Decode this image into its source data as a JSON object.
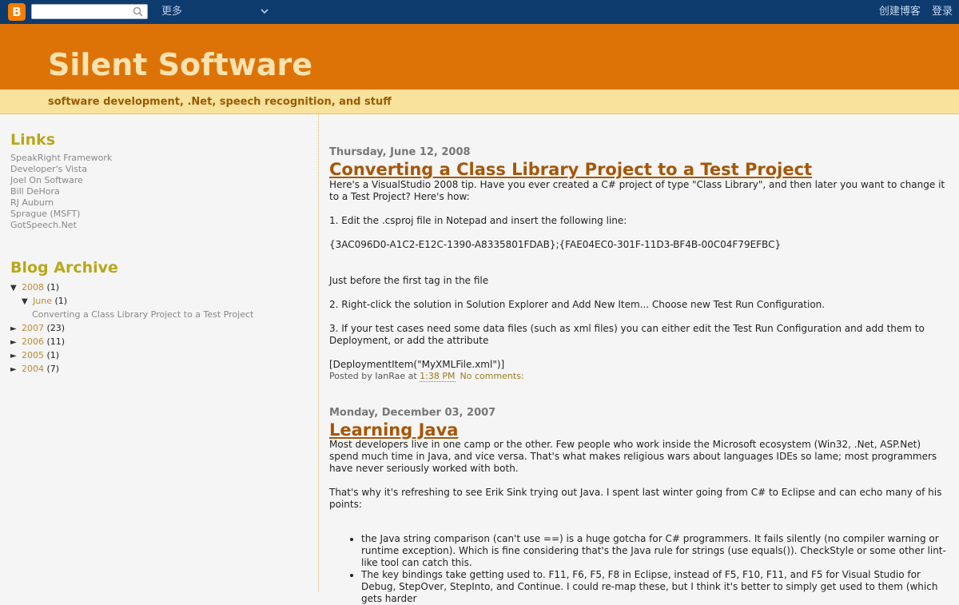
{
  "navbar": {
    "logo": "B",
    "search_placeholder": "",
    "more_label": "更多",
    "create_blog": "创建博客",
    "login": "登录"
  },
  "header": {
    "title": "Silent Software",
    "description": "software development, .Net, speech recognition, and stuff"
  },
  "sidebar": {
    "links_heading": "Links",
    "links": [
      "SpeakRight Framework",
      "Developer's Vista",
      "Joel On Software",
      "Bill DeHora",
      "RJ Auburn",
      "Sprague (MSFT)",
      "GotSpeech.Net"
    ],
    "archive_heading": "Blog Archive",
    "archive": {
      "y2008": {
        "label": "2008",
        "count": "(1)",
        "toggle": "▼"
      },
      "june": {
        "label": "June",
        "count": "(1)",
        "toggle": "▼"
      },
      "june_post": "Converting a Class Library Project to a Test Project",
      "y2007": {
        "label": "2007",
        "count": "(23)",
        "toggle": "►"
      },
      "y2006": {
        "label": "2006",
        "count": "(11)",
        "toggle": "►"
      },
      "y2005": {
        "label": "2005",
        "count": "(1)",
        "toggle": "►"
      },
      "y2004": {
        "label": "2004",
        "count": "(7)",
        "toggle": "►"
      }
    }
  },
  "posts": [
    {
      "date": "Thursday, June 12, 2008",
      "title": "Converting a Class Library Project to a Test Project",
      "p1": "Here's a VisualStudio 2008 tip. Have you ever created a C# project of type \"Class Library\", and then later you want to change it to a Test Project? Here's how:",
      "p2": "1. Edit the .csproj file in Notepad and insert the following line:",
      "p3": "{3AC096D0-A1C2-E12C-1390-A8335801FDAB};{FAE04EC0-301F-11D3-BF4B-00C04F79EFBC}",
      "p4": "Just before the first tag in the file",
      "p5": "2. Right-click the solution in Solution Explorer and Add New Item... Choose new Test Run Configuration.",
      "p6": "3. If your test cases need some data files (such as xml files) you can either edit the Test Run Configuration and add them to Deployment, or add the attribute",
      "p7": "[DeploymentItem(\"MyXMLFile.xml\")]",
      "posted_by": "Posted by IanRae at ",
      "time": "1:38 PM",
      "comments": "No comments:"
    },
    {
      "date": "Monday, December 03, 2007",
      "title": "Learning Java",
      "p1": "Most developers live in one camp or the other. Few people who work inside the Microsoft ecosystem (Win32, .Net, ASP.Net) spend much time in Java, and vice versa. That's what makes religious wars about languages IDEs so lame; most programmers have never seriously worked with both.",
      "p2": "That's why it's refreshing to see Erik Sink trying out Java. I spent last winter going from C# to Eclipse and can echo many of his points:",
      "bullets": [
        "the Java string comparison (can't use ==) is a huge gotcha for C# programmers. It fails silently (no compiler warning or runtime exception). Which is fine considering that's the Java rule for strings (use equals()). CheckStyle or some other lint-like tool can catch this.",
        "The key bindings take getting used to. F11, F6, F5, F8 in Eclipse, instead of F5, F10, F11, and F5 for Visual Studio for Debug, StepOver, StepInto, and Continue. I could re-map these, but I think it's better to simply get used to them (which gets harder"
      ]
    }
  ]
}
